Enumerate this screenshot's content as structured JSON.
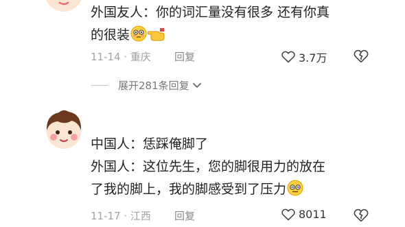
{
  "comments": [
    {
      "lines": [
        "外国友人：你的词汇量没有很多 还有你真",
        "的很装"
      ],
      "emojis": [
        "flushed-face",
        "hand-pointing"
      ],
      "date_location": "11-14 · 重庆",
      "reply_label": "回复",
      "likes": "3.7万"
    },
    {
      "lines": [
        "中国人：恁踩俺脚了",
        "外国人：这位先生，您的脚很用力的放在",
        "了我的脚上，我的脚感受到了压力"
      ],
      "emojis": [
        "dizzy-face"
      ],
      "date_location": "11-17 · 江西",
      "reply_label": "回复",
      "likes": "8011"
    }
  ],
  "expand_replies_label": "展开281条回复",
  "colors": {
    "meta_text": "#a3a3a3",
    "body_text": "#222222",
    "avatar_skin": "#fde5d4",
    "avatar_hair": "#6b3a1e",
    "avatar_cheek": "#f7a1a1"
  }
}
